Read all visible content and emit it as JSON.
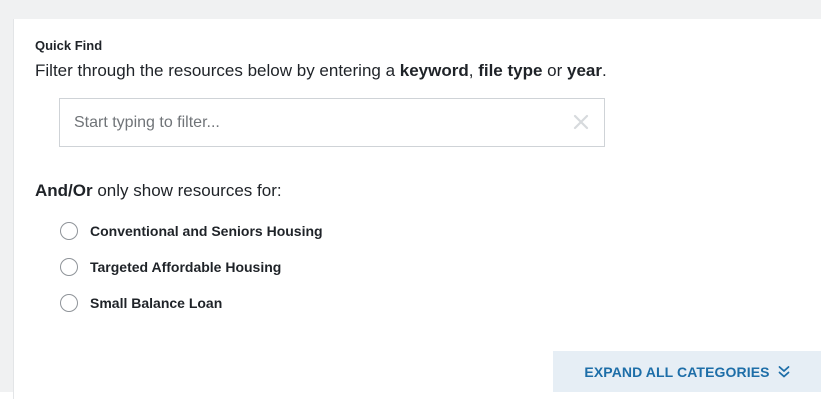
{
  "quick_find": {
    "label": "Quick Find",
    "description_pre": "Filter through the resources below by entering a ",
    "keyword": "keyword",
    "sep1": ", ",
    "file_type": "file type",
    "sep2": " or ",
    "year": "year",
    "end": ".",
    "search_placeholder": "Start typing to filter...",
    "search_value": ""
  },
  "filters": {
    "andor_bold": "And/Or",
    "andor_rest": " only show resources for:",
    "options": [
      {
        "label": "Conventional and Seniors Housing",
        "selected": false
      },
      {
        "label": "Targeted Affordable Housing",
        "selected": false
      },
      {
        "label": "Small Balance Loan",
        "selected": false
      }
    ]
  },
  "expand": {
    "label": "EXPAND ALL CATEGORIES",
    "icon": "double-chevron-down-icon"
  },
  "colors": {
    "accent": "#1d6ea8",
    "button_bg": "#e6eef5"
  }
}
